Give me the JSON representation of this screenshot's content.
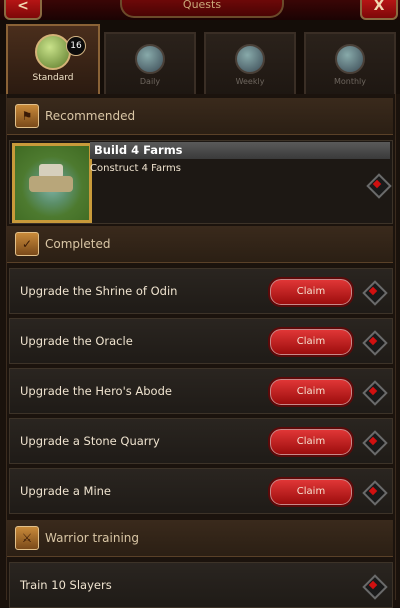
{
  "header": {
    "title": "Quests",
    "back_label": "<",
    "close_label": "X"
  },
  "tabs": [
    {
      "label": "Standard",
      "badge": "16",
      "active": true
    },
    {
      "label": "Daily"
    },
    {
      "label": "Weekly"
    },
    {
      "label": "Monthly"
    }
  ],
  "sections": {
    "recommended": {
      "title": "Recommended"
    },
    "completed": {
      "title": "Completed"
    },
    "warrior": {
      "title": "Warrior training"
    }
  },
  "featured": {
    "title": "Build 4 Farms",
    "description": "Construct 4 Farms"
  },
  "completed_items": [
    {
      "label": "Upgrade the Shrine of Odin",
      "button": "Claim"
    },
    {
      "label": "Upgrade the Oracle",
      "button": "Claim"
    },
    {
      "label": "Upgrade the Hero's Abode",
      "button": "Claim"
    },
    {
      "label": "Upgrade a Stone Quarry",
      "button": "Claim"
    },
    {
      "label": "Upgrade a Mine",
      "button": "Claim"
    }
  ],
  "warrior_items": [
    {
      "label": "Train 10 Slayers"
    }
  ],
  "colors": {
    "accent_red": "#d01010",
    "gold": "#c89a3a"
  }
}
